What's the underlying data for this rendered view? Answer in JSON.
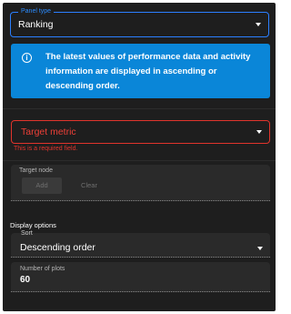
{
  "panel_type": {
    "label": "Panel type",
    "value": "Ranking"
  },
  "info": {
    "icon": "info-icon",
    "glyph": "i",
    "text": "The latest values of performance data and activity information are displayed in ascending or descending order."
  },
  "target_metric": {
    "placeholder": "Target metric",
    "error": "This is a required field."
  },
  "target_node": {
    "label": "Target node",
    "add_label": "Add",
    "clear_label": "Clear"
  },
  "display_options": {
    "heading": "Display options",
    "sort": {
      "label": "Sort",
      "value": "Descending order"
    },
    "number_of_plots": {
      "label": "Number of plots",
      "value": "60"
    }
  },
  "colors": {
    "panel_background": "#1e1e1e",
    "accent_blue": "#2b7fff",
    "info_background": "#0a86d8",
    "error_red": "#e0342c"
  }
}
